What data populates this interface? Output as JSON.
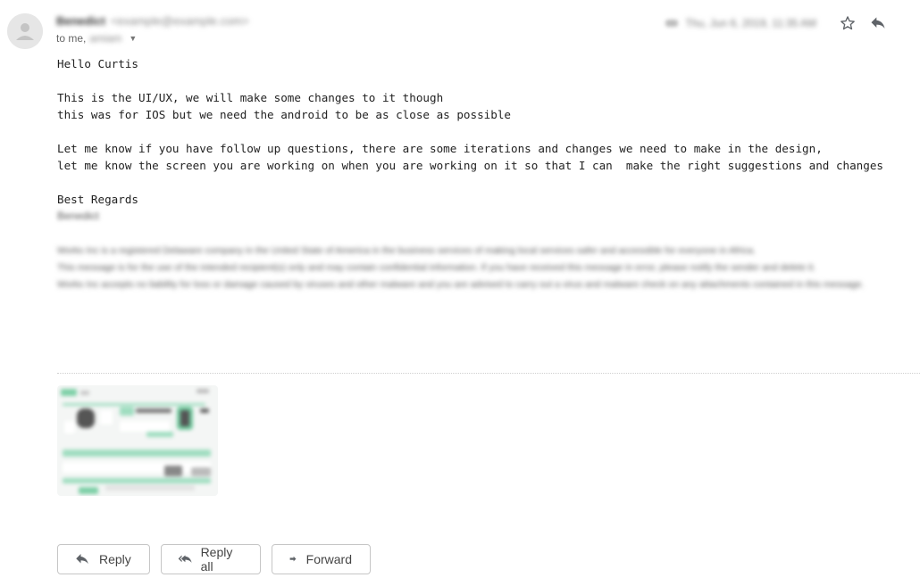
{
  "header": {
    "sender_name": "Benedict",
    "sender_email": "<example@example.com>",
    "to_prefix": "to me,",
    "to_other": "amiam",
    "date": "Thu, Jun 6, 2019, 11:35 AM",
    "icons": [
      "star-icon",
      "reply-icon"
    ]
  },
  "body": {
    "greeting": "Hello Curtis",
    "lines_1": [
      "This is the UI/UX, we will make some changes to it though",
      "this was for IOS but we need the android to be as close as possible"
    ],
    "lines_2": [
      "Let me know if you have follow up questions, there are some iterations and changes we need to make in the design,",
      "let me know the screen you are working on when you are working on it so that I can  make the right suggestions and changes"
    ],
    "closing": "Best Regards",
    "signature_name": "Benedict"
  },
  "disclaimer": {
    "lines": [
      "Works Inc is a registered Delaware company in the United State of America in the business services of making local services safer and accessible for everyone in Africa.",
      "This message is for the use of the intended recipient(s) only and may contain confidential information. If you have received this message in error, please notify the sender and delete it.",
      "Works Inc accepts no liability for loss or damage caused by viruses and other malware and you are advised to carry out a virus and malware check on any attachments contained in this message."
    ]
  },
  "actions": {
    "reply": "Reply",
    "reply_all": "Reply all",
    "forward": "Forward"
  },
  "colors": {
    "thumb_accent": "#8fd6b4",
    "icon_gray": "#5f6368"
  }
}
